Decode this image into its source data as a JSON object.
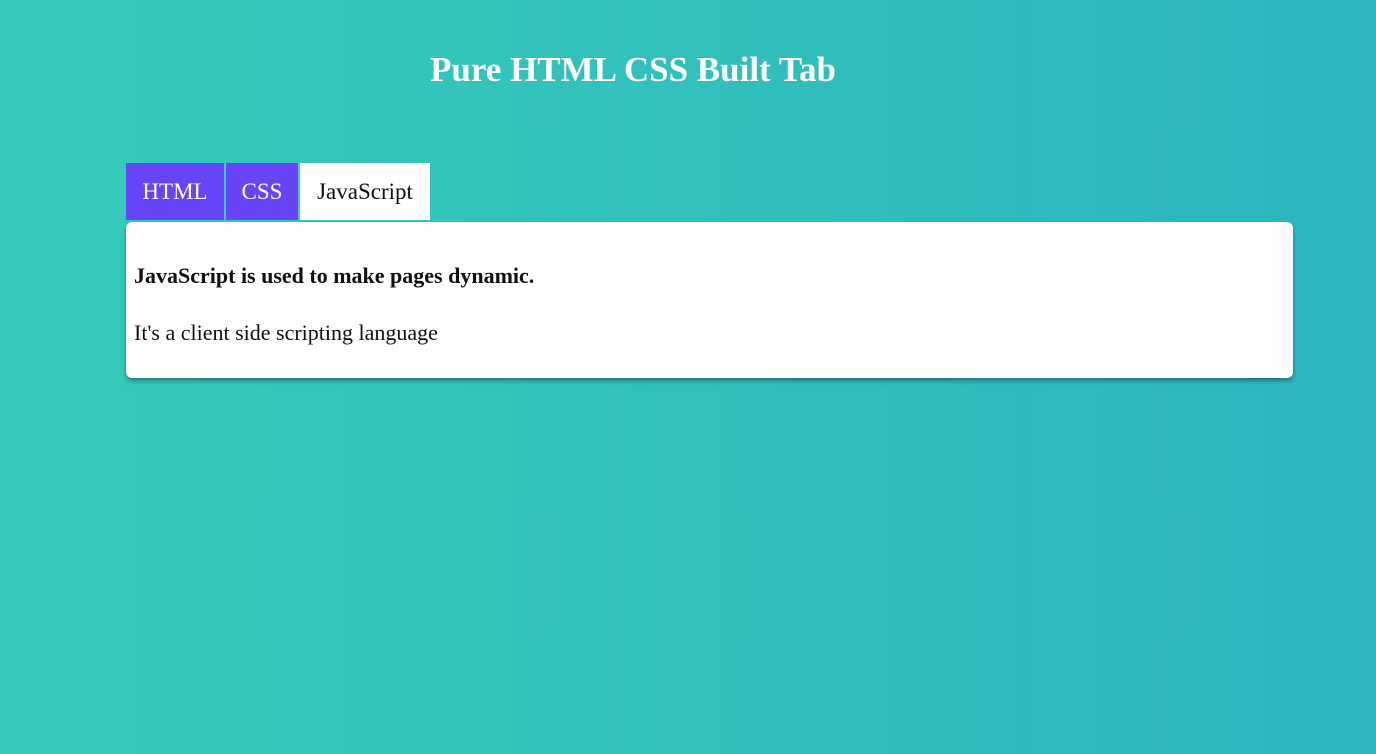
{
  "page": {
    "title": "Pure HTML CSS Built Tab"
  },
  "tabs": [
    {
      "label": "HTML",
      "active": false
    },
    {
      "label": "CSS",
      "active": false
    },
    {
      "label": "JavaScript",
      "active": true
    }
  ],
  "content": {
    "heading": "JavaScript is used to make pages dynamic.",
    "text": "It's a client side scripting language"
  },
  "colors": {
    "background_start": "#36cbb9",
    "background_end": "#2cb5bf",
    "tab_inactive": "#6744f8",
    "tab_active": "#ffffff"
  }
}
